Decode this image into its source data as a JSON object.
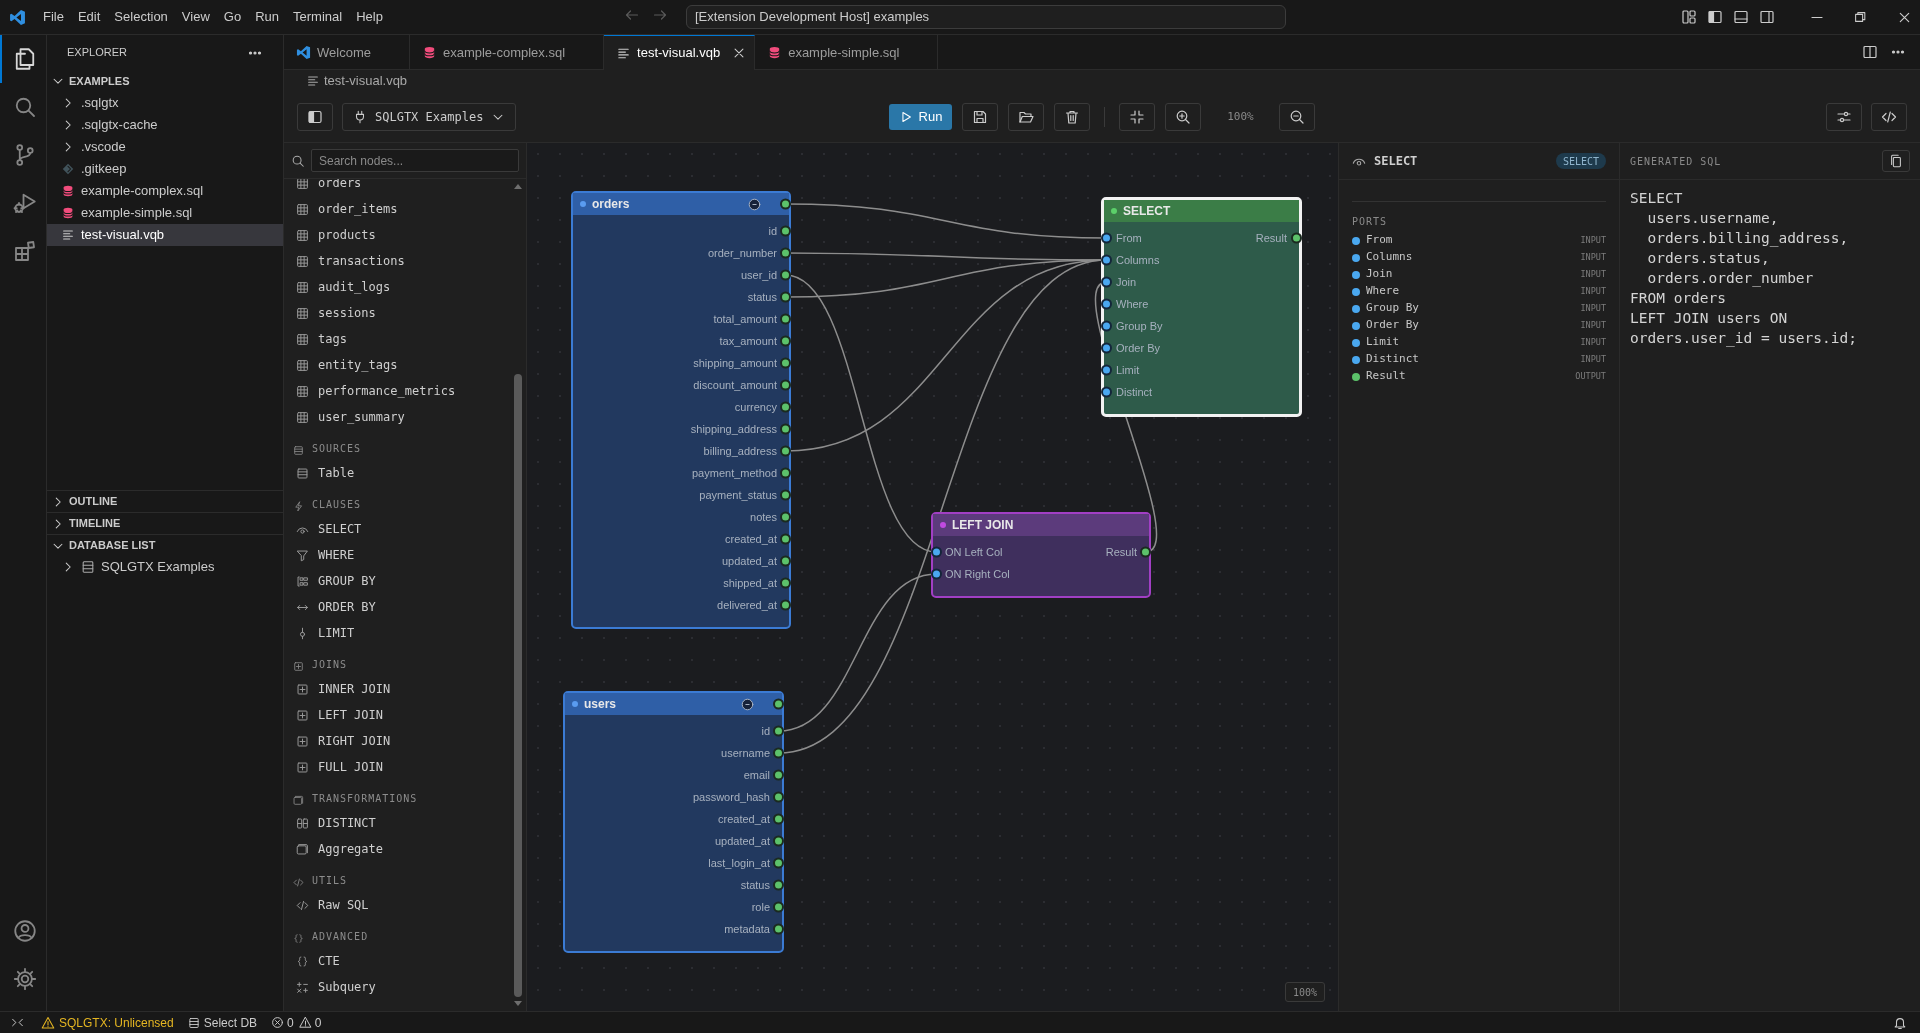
{
  "title_bar": {
    "menu": [
      "File",
      "Edit",
      "Selection",
      "View",
      "Go",
      "Run",
      "Terminal",
      "Help"
    ],
    "command_center": "[Extension Development Host] examples"
  },
  "activity_bar": {
    "top": [
      {
        "kind": "explorer",
        "selected": true
      },
      {
        "kind": "search",
        "selected": false
      },
      {
        "kind": "source-control",
        "selected": false
      },
      {
        "kind": "run-debug",
        "selected": false
      },
      {
        "kind": "extensions",
        "selected": false
      }
    ],
    "bottom": [
      {
        "kind": "account"
      },
      {
        "kind": "settings"
      }
    ]
  },
  "explorer": {
    "title": "EXPLORER",
    "folder": "EXAMPLES",
    "files": [
      {
        "label": ".sqlgtx",
        "kind": "folder",
        "selected": false
      },
      {
        "label": ".sqlgtx-cache",
        "kind": "folder",
        "selected": false
      },
      {
        "label": ".vscode",
        "kind": "folder",
        "selected": false
      },
      {
        "label": ".gitkeep",
        "kind": "gitkeep",
        "selected": false
      },
      {
        "label": "example-complex.sql",
        "kind": "sql",
        "selected": false
      },
      {
        "label": "example-simple.sql",
        "kind": "sql",
        "selected": false
      },
      {
        "label": "test-visual.vqb",
        "kind": "vqb",
        "selected": true
      }
    ],
    "sections": [
      {
        "label": "OUTLINE",
        "expanded": false
      },
      {
        "label": "TIMELINE",
        "expanded": false
      },
      {
        "label": "DATABASE LIST",
        "expanded": true,
        "items": [
          "SQLGTX Examples"
        ]
      }
    ]
  },
  "tabs": [
    {
      "label": "Welcome",
      "kind": "welcome",
      "selected": false
    },
    {
      "label": "example-complex.sql",
      "kind": "sql",
      "selected": false
    },
    {
      "label": "test-visual.vqb",
      "kind": "vqb",
      "selected": true
    },
    {
      "label": "example-simple.sql",
      "kind": "sql",
      "selected": false
    }
  ],
  "breadcrumb": "test-visual.vqb",
  "toolbar": {
    "connection": "SQLGTX Examples",
    "run": "Run",
    "zoom": "100%"
  },
  "palette": {
    "placeholder": "Search nodes...",
    "groups": [
      {
        "kind": "tables",
        "items": [
          {
            "label": "orders",
            "kind": "table"
          },
          {
            "label": "order_items",
            "kind": "table"
          },
          {
            "label": "products",
            "kind": "table"
          },
          {
            "label": "transactions",
            "kind": "table"
          },
          {
            "label": "audit_logs",
            "kind": "table"
          },
          {
            "label": "sessions",
            "kind": "table"
          },
          {
            "label": "tags",
            "kind": "table"
          },
          {
            "label": "entity_tags",
            "kind": "table"
          },
          {
            "label": "performance_metrics",
            "kind": "table"
          },
          {
            "label": "user_summary",
            "kind": "table"
          }
        ]
      },
      {
        "kind": "sources",
        "label": "SOURCES",
        "items": [
          {
            "label": "Table",
            "kind": "source"
          }
        ]
      },
      {
        "kind": "clauses",
        "label": "CLAUSES",
        "items": [
          {
            "label": "SELECT",
            "kind": "select"
          },
          {
            "label": "WHERE",
            "kind": "where"
          },
          {
            "label": "GROUP BY",
            "kind": "group"
          },
          {
            "label": "ORDER BY",
            "kind": "order"
          },
          {
            "label": "LIMIT",
            "kind": "limit"
          }
        ]
      },
      {
        "kind": "joins",
        "label": "JOINS",
        "items": [
          {
            "label": "INNER JOIN",
            "kind": "join"
          },
          {
            "label": "LEFT JOIN",
            "kind": "join"
          },
          {
            "label": "RIGHT JOIN",
            "kind": "join"
          },
          {
            "label": "FULL JOIN",
            "kind": "join"
          }
        ]
      },
      {
        "kind": "transformations",
        "label": "TRANSFORMATIONS",
        "items": [
          {
            "label": "DISTINCT",
            "kind": "distinct"
          },
          {
            "label": "Aggregate",
            "kind": "aggregate"
          }
        ]
      },
      {
        "kind": "utils",
        "label": "UTILS",
        "items": [
          {
            "label": "Raw SQL",
            "kind": "raw"
          }
        ]
      },
      {
        "kind": "advanced",
        "label": "ADVANCED",
        "items": [
          {
            "label": "CTE",
            "kind": "cte"
          },
          {
            "label": "Subquery",
            "kind": "subquery"
          }
        ]
      }
    ]
  },
  "canvas": {
    "zoom": "100%",
    "nodes": [
      {
        "kind": "table",
        "title": "orders",
        "selected": false,
        "columns": [
          "id",
          "order_number",
          "user_id",
          "status",
          "total_amount",
          "tax_amount",
          "shipping_amount",
          "discount_amount",
          "currency",
          "shipping_address",
          "billing_address",
          "payment_method",
          "payment_status",
          "notes",
          "created_at",
          "updated_at",
          "shipped_at",
          "delivered_at"
        ]
      },
      {
        "kind": "table",
        "title": "users",
        "selected": false,
        "columns": [
          "id",
          "username",
          "email",
          "password_hash",
          "created_at",
          "updated_at",
          "last_login_at",
          "status",
          "role",
          "metadata"
        ]
      },
      {
        "kind": "select",
        "title": "SELECT",
        "selected": true,
        "inputs": [
          "From",
          "Columns",
          "Join",
          "Where",
          "Group By",
          "Order By",
          "Limit",
          "Distinct"
        ],
        "output": "Result"
      },
      {
        "kind": "join",
        "title": "LEFT JOIN",
        "selected": false,
        "inputs": [
          "ON Left Col",
          "ON Right Col"
        ],
        "output": "Result"
      }
    ]
  },
  "properties": {
    "title": "SELECT",
    "badge": "SELECT",
    "heading": "PORTS",
    "ports": [
      {
        "name": "From",
        "direction": "INPUT",
        "kind": "input"
      },
      {
        "name": "Columns",
        "direction": "INPUT",
        "kind": "input"
      },
      {
        "name": "Join",
        "direction": "INPUT",
        "kind": "input"
      },
      {
        "name": "Where",
        "direction": "INPUT",
        "kind": "input"
      },
      {
        "name": "Group By",
        "direction": "INPUT",
        "kind": "input"
      },
      {
        "name": "Order By",
        "direction": "INPUT",
        "kind": "input"
      },
      {
        "name": "Limit",
        "direction": "INPUT",
        "kind": "input"
      },
      {
        "name": "Distinct",
        "direction": "INPUT",
        "kind": "input"
      },
      {
        "name": "Result",
        "direction": "OUTPUT",
        "kind": "output"
      }
    ]
  },
  "generated_sql": {
    "title": "GENERATED SQL",
    "lines": [
      "SELECT",
      "  users.username,",
      "  orders.billing_address,",
      "  orders.status,",
      "  orders.order_number",
      "FROM orders",
      "LEFT JOIN users ON",
      "orders.user_id = users.id;"
    ]
  },
  "status_bar": {
    "license": "SQLGTX: Unlicensed",
    "database": "Select DB",
    "errors": "0",
    "warnings": "0"
  }
}
